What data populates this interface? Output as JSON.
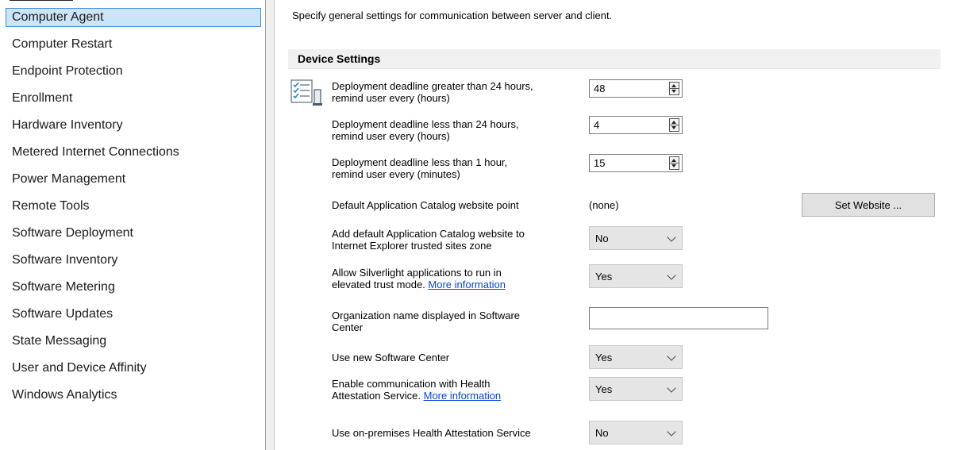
{
  "sidebar": {
    "items": [
      {
        "label": "Computer Agent",
        "selected": true
      },
      {
        "label": "Computer Restart"
      },
      {
        "label": "Endpoint Protection"
      },
      {
        "label": "Enrollment"
      },
      {
        "label": "Hardware Inventory"
      },
      {
        "label": "Metered Internet Connections"
      },
      {
        "label": "Power Management"
      },
      {
        "label": "Remote Tools"
      },
      {
        "label": "Software Deployment"
      },
      {
        "label": "Software Inventory"
      },
      {
        "label": "Software Metering"
      },
      {
        "label": "Software Updates"
      },
      {
        "label": "State Messaging"
      },
      {
        "label": "User and Device Affinity"
      },
      {
        "label": "Windows Analytics"
      }
    ]
  },
  "main": {
    "description": "Specify general settings for communication between server and client.",
    "group_title": "Device Settings",
    "settings_icon": "checklist-settings-icon",
    "deadline_24h_plus": {
      "label_line1": "Deployment deadline greater than 24 hours,",
      "label_line2": "remind user every (hours)",
      "value": "48"
    },
    "deadline_24h_less": {
      "label_line1": "Deployment deadline less than 24 hours,",
      "label_line2": "remind user every (hours)",
      "value": "4"
    },
    "deadline_1h_less": {
      "label_line1": "Deployment deadline less than 1 hour,",
      "label_line2": "remind user every (minutes)",
      "value": "15"
    },
    "app_catalog_point": {
      "label": "Default Application Catalog website point",
      "value": "(none)",
      "button_label": "Set Website ..."
    },
    "trusted_sites": {
      "label_line1": "Add default Application Catalog website to",
      "label_line2": "Internet Explorer trusted sites zone",
      "value": "No"
    },
    "silverlight": {
      "label_line1": "Allow Silverlight applications to run in",
      "label_line2_prefix": "elevated trust mode. ",
      "link": "More information",
      "value": "Yes"
    },
    "org_name": {
      "label_line1": "Organization name displayed in Software",
      "label_line2": "Center",
      "value": ""
    },
    "new_software_center": {
      "label": "Use new Software Center",
      "value": "Yes"
    },
    "health_attestation": {
      "label_line1": "Enable communication with Health",
      "label_line2_prefix": "Attestation Service. ",
      "link": "More information",
      "value": "Yes"
    },
    "onprem_health": {
      "label": "Use on-premises Health Attestation Service",
      "value": "No"
    }
  },
  "colors": {
    "selection_bg": "#cce4f7",
    "selection_border": "#3d8ee0",
    "link": "#0645d8",
    "group_header_bg": "#f0f0f0"
  }
}
